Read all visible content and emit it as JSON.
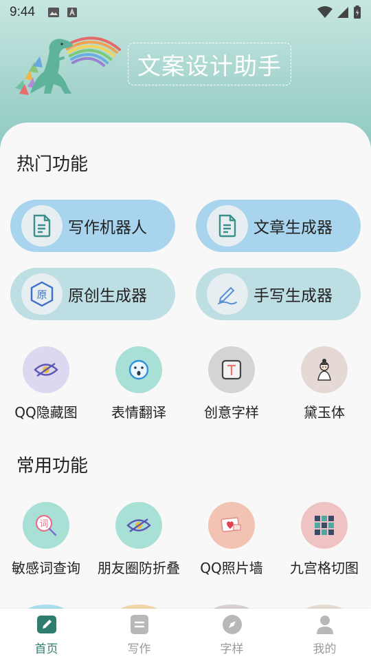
{
  "status_bar": {
    "time": "9:44"
  },
  "header": {
    "title": "文案设计助手"
  },
  "hot": {
    "title": "热门功能",
    "pills": [
      {
        "label": "写作机器人",
        "icon": "document-icon"
      },
      {
        "label": "文章生成器",
        "icon": "document-icon"
      },
      {
        "label": "原创生成器",
        "icon": "original-icon"
      },
      {
        "label": "手写生成器",
        "icon": "pen-icon"
      }
    ],
    "grid": [
      {
        "label": "QQ隐藏图",
        "icon": "eye-hidden-icon"
      },
      {
        "label": "表情翻译",
        "icon": "emoji-icon"
      },
      {
        "label": "创意字样",
        "icon": "text-frame-icon"
      },
      {
        "label": "黛玉体",
        "icon": "avatar-girl-icon"
      }
    ]
  },
  "common": {
    "title": "常用功能",
    "grid": [
      {
        "label": "敏感词查询",
        "icon": "word-search-icon"
      },
      {
        "label": "朋友圈防折叠",
        "icon": "eye-hidden-icon"
      },
      {
        "label": "QQ照片墙",
        "icon": "photo-heart-icon"
      },
      {
        "label": "九宫格切图",
        "icon": "grid-nine-icon"
      }
    ]
  },
  "bottom_nav": [
    {
      "label": "首页",
      "icon": "edit-icon",
      "active": true
    },
    {
      "label": "写作",
      "icon": "list-icon",
      "active": false
    },
    {
      "label": "字样",
      "icon": "compass-icon",
      "active": false
    },
    {
      "label": "我的",
      "icon": "user-icon",
      "active": false
    }
  ],
  "colors": {
    "accent": "#2e7d6e",
    "header_bg": "#8fcac2",
    "pill_blue": "#a8d4ee",
    "pill_teal": "#bddfe4"
  }
}
